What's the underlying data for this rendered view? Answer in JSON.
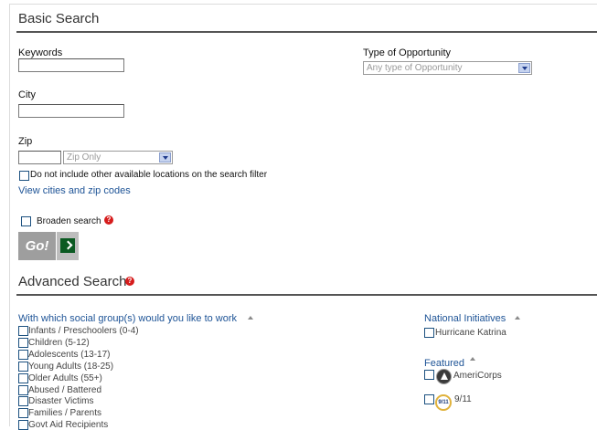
{
  "basic_search": {
    "title": "Basic Search",
    "keywords_label": "Keywords",
    "keywords_value": "",
    "type_label": "Type of Opportunity",
    "type_selected": "Any type of Opportunity",
    "city_label": "City",
    "city_value": "",
    "zip_label": "Zip",
    "zip_value": "",
    "zip_scope_selected": "Zip Only",
    "exclude_locations_label": "Do not include other available locations on the search filter",
    "view_cities_link": "View cities and zip codes",
    "broaden_label": "Broaden search",
    "go_label": "Go!"
  },
  "advanced_search": {
    "title": "Advanced Search",
    "social_groups": {
      "heading": "With which social group(s) would you like to work",
      "items": [
        {
          "label": "Infants / Preschoolers (0-4)"
        },
        {
          "label": "Children (5-12)"
        },
        {
          "label": "Adolescents (13-17)"
        },
        {
          "label": "Young Adults (18-25)"
        },
        {
          "label": "Older Adults (55+)"
        },
        {
          "label": "Abused / Battered"
        },
        {
          "label": "Disaster Victims"
        },
        {
          "label": "Families / Parents"
        },
        {
          "label": "Govt Aid Recipients"
        }
      ]
    },
    "national_initiatives": {
      "heading": "National Initiatives",
      "items": [
        {
          "label": "Hurricane Katrina"
        }
      ]
    },
    "featured": {
      "heading": "Featured",
      "items": [
        {
          "label": "AmeriCorps",
          "icon": "americorps-logo-icon"
        },
        {
          "label": "9/11",
          "icon": "911-logo-icon",
          "icon_text": "9/11"
        }
      ]
    }
  },
  "colors": {
    "link": "#1d5396",
    "help_icon": "#d61c1c",
    "go_button": "#9e9e9e",
    "go_arrow": "#0b5a22"
  }
}
